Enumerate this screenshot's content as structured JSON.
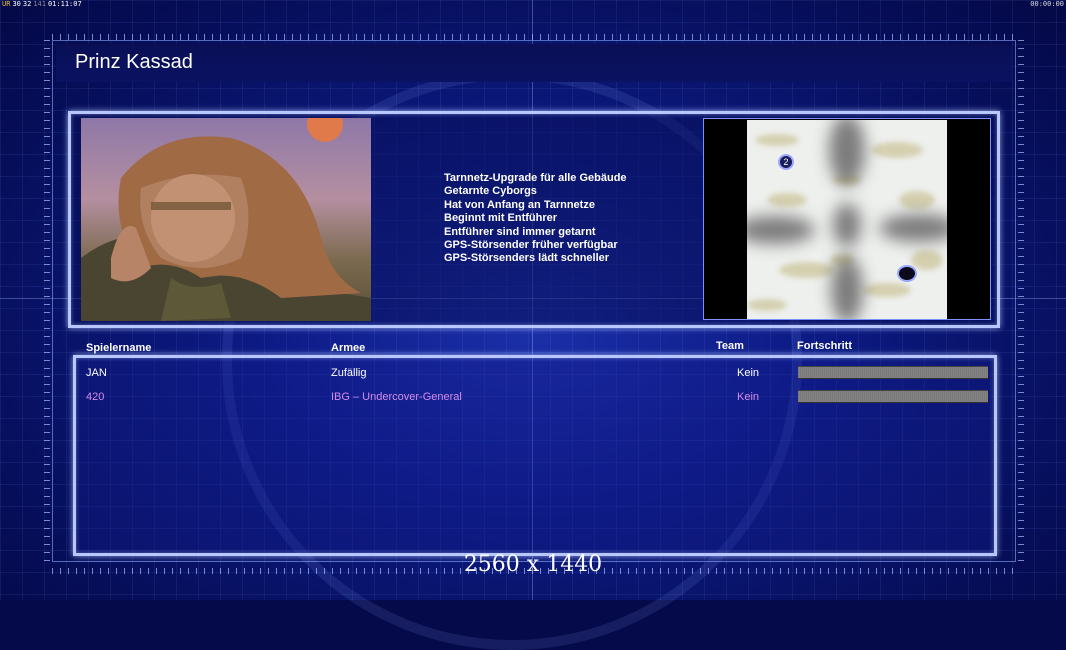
{
  "hud": {
    "left": [
      "UR",
      "30",
      "32",
      "141",
      "01:11:07"
    ],
    "right": "00:00:00"
  },
  "title": "Prinz Kassad",
  "perks": [
    "Tarnnetz-Upgrade für alle Gebäude",
    "Getarnte Cyborgs",
    "Hat von Anfang an Tarnnetze",
    "Beginnt mit Entführer",
    "Entführer sind immer getarnt",
    "GPS-Störsender früher verfügbar",
    "GPS-Störsenders lädt schneller"
  ],
  "minimap": {
    "start_positions": [
      "2",
      ""
    ]
  },
  "table": {
    "headers": {
      "player": "Spielername",
      "army": "Armee",
      "team": "Team",
      "progress": "Fortschritt"
    },
    "rows": [
      {
        "player": "JAN",
        "army": "Zufällig",
        "team": "Kein",
        "color": "#ffffff"
      },
      {
        "player": "420",
        "army": "IBG – Undercover-General",
        "team": "Kein",
        "color": "#d58be8"
      }
    ]
  },
  "resolution_label": "2560 x 1440"
}
